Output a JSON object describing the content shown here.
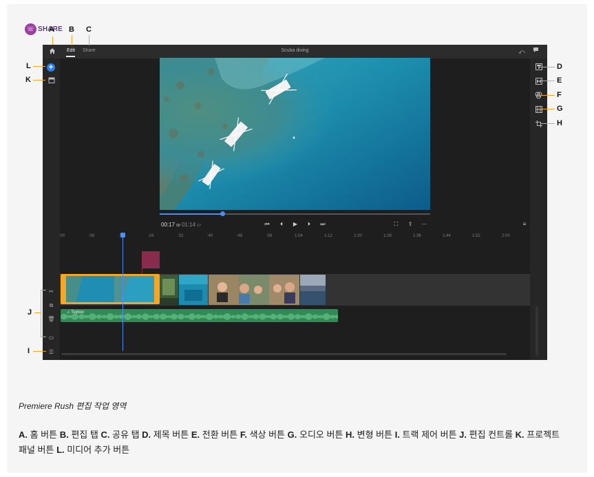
{
  "logo": {
    "text": "SHARE",
    "icon": "chat-bubble-icon"
  },
  "app": {
    "title": "Scuba diving",
    "tabs": [
      {
        "label": "Edit",
        "active": true
      },
      {
        "label": "Share",
        "active": false
      }
    ],
    "icons": {
      "home": "home-icon",
      "undo": "undo-icon",
      "feedback": "comment-icon"
    },
    "timecode": {
      "current": "00:17",
      "current_frames": "00",
      "duration": "01:14",
      "duration_frames": "17"
    },
    "progress": 0.23,
    "ruler_ticks": [
      ":00",
      ":08",
      ":16",
      ":24",
      ":32",
      ":40",
      ":48",
      ":56",
      "1:04",
      "1:12",
      "1:20",
      "1:28",
      "1:36",
      "1:44",
      "1:52",
      "2:00"
    ],
    "audio_clip_name": "Toybox",
    "accent_color": "#2f7ff0",
    "selection_color": "#f5a623",
    "audio_color": "#2f8a55",
    "title_clip_color": "#8a2a4c"
  },
  "callouts": {
    "A": "A",
    "B": "B",
    "C": "C",
    "D": "D",
    "E": "E",
    "F": "F",
    "G": "G",
    "H": "H",
    "I": "I",
    "J": "J",
    "K": "K",
    "L": "L"
  },
  "caption": "Premiere Rush 편집 작업 영역",
  "legend": [
    {
      "letter": "A.",
      "text": " 홈 버튼 "
    },
    {
      "letter": "B.",
      "text": " 편집 탭 "
    },
    {
      "letter": "C.",
      "text": " 공유 탭 "
    },
    {
      "letter": "D.",
      "text": " 제목 버튼 "
    },
    {
      "letter": "E.",
      "text": " 전환 버튼 "
    },
    {
      "letter": "F.",
      "text": " 색상 버튼 "
    },
    {
      "letter": "G.",
      "text": " 오디오 버튼 "
    },
    {
      "letter": "H.",
      "text": " 변형 버튼 "
    },
    {
      "letter": "I.",
      "text": " 트랙 제어 버튼 "
    },
    {
      "letter": "J.",
      "text": " 편집 컨트롤 "
    },
    {
      "letter": "K.",
      "text": " 프로젝트 패널 버튼 "
    },
    {
      "letter": "L.",
      "text": " 미디어 추가 버튼"
    }
  ]
}
